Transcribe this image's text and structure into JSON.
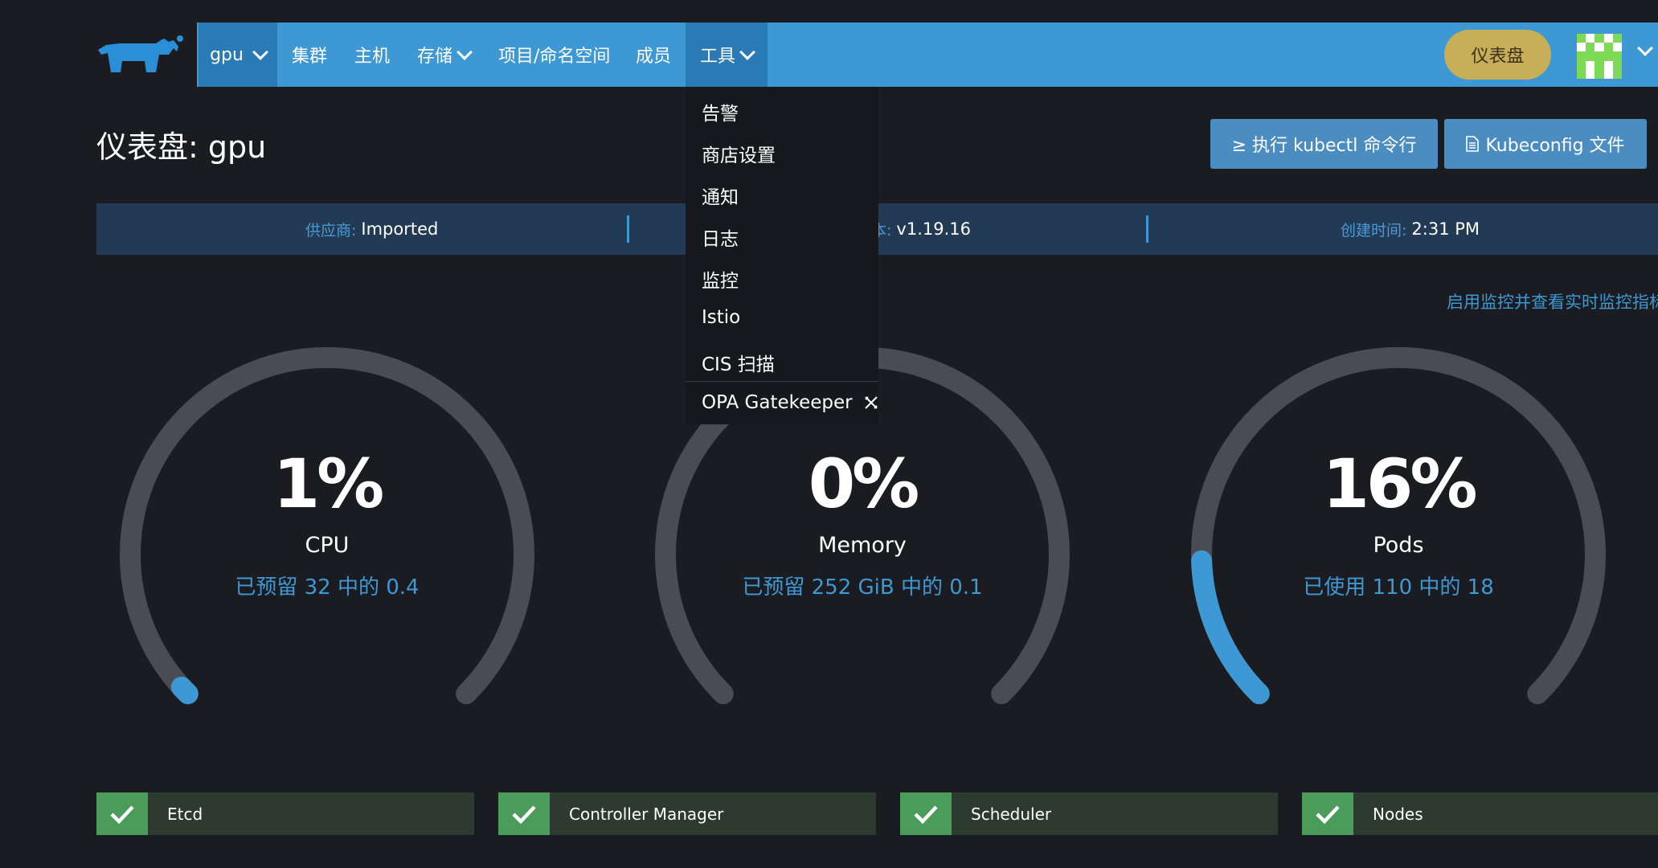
{
  "nav": {
    "cluster": "gpu",
    "items": [
      {
        "label": "集群",
        "dropdown": false
      },
      {
        "label": "主机",
        "dropdown": false
      },
      {
        "label": "存储",
        "dropdown": true
      },
      {
        "label": "项目/命名空间",
        "dropdown": false
      },
      {
        "label": "成员",
        "dropdown": false
      },
      {
        "label": "工具",
        "dropdown": true
      }
    ],
    "dashboard_button": "仪表盘"
  },
  "tools_menu": [
    "告警",
    "商店设置",
    "通知",
    "日志",
    "监控",
    "Istio",
    "CIS 扫描",
    "OPA Gatekeeper"
  ],
  "page": {
    "title": "仪表盘: gpu",
    "kubectl_button": "≥ 执行 kubectl 命令行",
    "kubeconfig_button": "Kubeconfig 文件"
  },
  "info": {
    "provider_label": "供应商:",
    "provider_value": "Imported",
    "version_label": "版本:",
    "version_value": "v1.19.16",
    "created_label": "创建时间:",
    "created_value": "2:31 PM"
  },
  "monitor_link": "启用监控并查看实时监控指标",
  "gauges": [
    {
      "percent": "1%",
      "name": "CPU",
      "detail": "已预留 32 中的 0.4",
      "fill": 0.01
    },
    {
      "percent": "0%",
      "name": "Memory",
      "detail": "已预留 252 GiB 中的 0.1",
      "fill": 0.0
    },
    {
      "percent": "16%",
      "name": "Pods",
      "detail": "已使用 110 中的 18",
      "fill": 0.16
    }
  ],
  "components": [
    "Etcd",
    "Controller Manager",
    "Scheduler",
    "Nodes"
  ],
  "colors": {
    "nav": "#3d98d3",
    "accent": "#3d98d3",
    "gauge_track": "#4a4b53",
    "ok": "#4b9b5b",
    "dashboard_btn": "#c8ae57"
  }
}
